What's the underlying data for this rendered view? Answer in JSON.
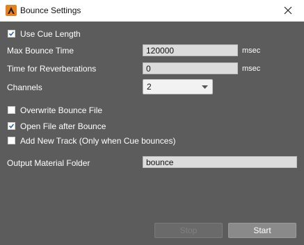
{
  "window": {
    "title": "Bounce Settings"
  },
  "form": {
    "use_cue_length": {
      "label": "Use Cue Length",
      "checked": true
    },
    "max_bounce_time": {
      "label": "Max Bounce Time",
      "value": "120000",
      "unit": "msec"
    },
    "reverb_time": {
      "label": "Time for Reverberations",
      "value": "0",
      "unit": "msec"
    },
    "channels": {
      "label": "Channels",
      "value": "2"
    },
    "overwrite": {
      "label": "Overwrite Bounce File",
      "checked": false
    },
    "open_after": {
      "label": "Open File after Bounce",
      "checked": true
    },
    "add_track": {
      "label": "Add New Track  (Only when Cue bounces)",
      "checked": false
    },
    "output_folder": {
      "label": "Output Material Folder",
      "value": "bounce"
    }
  },
  "buttons": {
    "stop": "Stop",
    "start": "Start"
  },
  "colors": {
    "panel_bg": "#5c5c5c",
    "accent_orange": "#e8801e"
  }
}
